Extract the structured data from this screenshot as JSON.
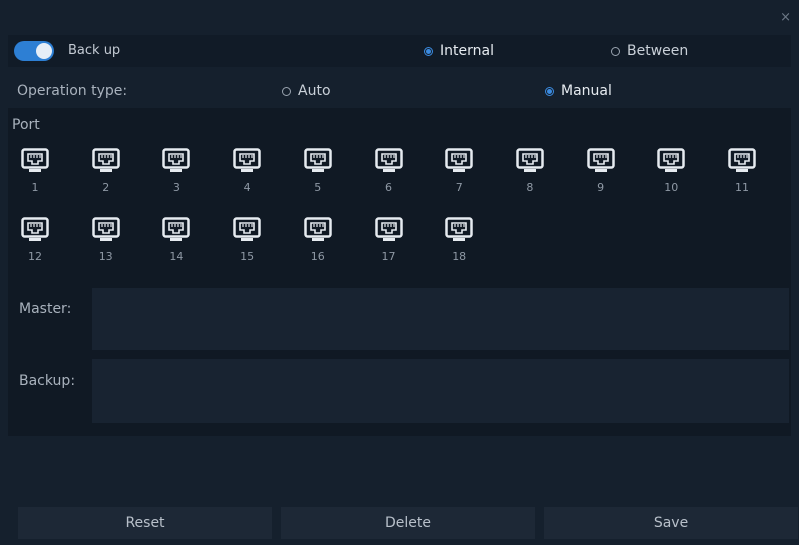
{
  "dialog": {
    "close_glyph": "×"
  },
  "backup": {
    "toggle_label": "Back up",
    "toggle_on": true,
    "options": [
      {
        "label": "Internal",
        "selected": true
      },
      {
        "label": "Between",
        "selected": false
      }
    ]
  },
  "operation": {
    "label": "Operation type:",
    "options": [
      {
        "label": "Auto",
        "selected": false
      },
      {
        "label": "Manual",
        "selected": true
      }
    ]
  },
  "ports": {
    "title": "Port",
    "items": [
      "1",
      "2",
      "3",
      "4",
      "5",
      "6",
      "7",
      "8",
      "9",
      "10",
      "11",
      "12",
      "13",
      "14",
      "15",
      "16",
      "17",
      "18"
    ],
    "icon": "ethernet-port-icon"
  },
  "fields": {
    "master_label": "Master:",
    "backup_label": "Backup:"
  },
  "actions": {
    "reset_label": "Reset",
    "delete_label": "Delete",
    "save_label": "Save"
  },
  "colors": {
    "accent": "#3b8be0",
    "panel": "#15202d",
    "button": "#1d2836"
  }
}
